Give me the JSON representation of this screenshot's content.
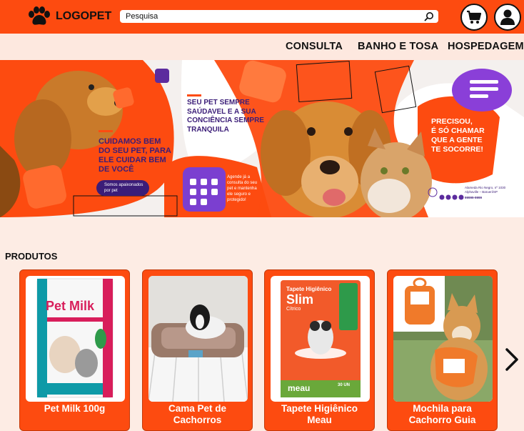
{
  "header": {
    "logo_text": "LOGOPET",
    "search_value": "Pesquisa"
  },
  "nav": {
    "items": [
      {
        "label": "CONSULTA"
      },
      {
        "label": "BANHO E TOSA"
      },
      {
        "label": "HOSPEDAGEM"
      }
    ]
  },
  "banner": {
    "headline": [
      "CUIDAMOS BEM",
      "DO SEU PET, PARA",
      "ELE CUIDAR BEM",
      "DE VOCÊ"
    ],
    "pill_text": [
      "Somos apaixonados",
      "por pet"
    ],
    "center_text": [
      "SEU PET SEMPRE",
      "SAÚDAVEL E A SUA",
      "CONCIÊNCIA SEMPRE",
      "TRANQUILA"
    ],
    "agende_text": [
      "Agende já a",
      "consulta do seu",
      "pet e mantenha",
      "ele seguro e",
      "protegido!"
    ],
    "right_text": [
      "PRECISOU,",
      "É SÓ CHAMAR",
      "QUE A GENTE",
      "TE SOCORRE!"
    ],
    "address": [
      "Alameda Rio Negro, nº 1030",
      "Alphaville – Barueri/SP"
    ],
    "phone": "99999-9999"
  },
  "products": {
    "title": "PRODUTOS",
    "items": [
      {
        "name": "Pet Milk 100g"
      },
      {
        "name": "Cama Pet de Cachorros"
      },
      {
        "name": "Tapete Higiênico Meau"
      },
      {
        "name": "Mochila para Cachorro Guia"
      }
    ],
    "pet_milk_label": "Pet Milk",
    "tapete_label": [
      "Tapete Higiênico",
      "Slim",
      "Cítrico"
    ],
    "tapete_brand": "meau",
    "tapete_count": "30 UN"
  },
  "colors": {
    "brand": "#fd4b10",
    "nav_bg": "#fde8df",
    "page_bg": "#fdece4",
    "purple": "#5c2c9e"
  }
}
